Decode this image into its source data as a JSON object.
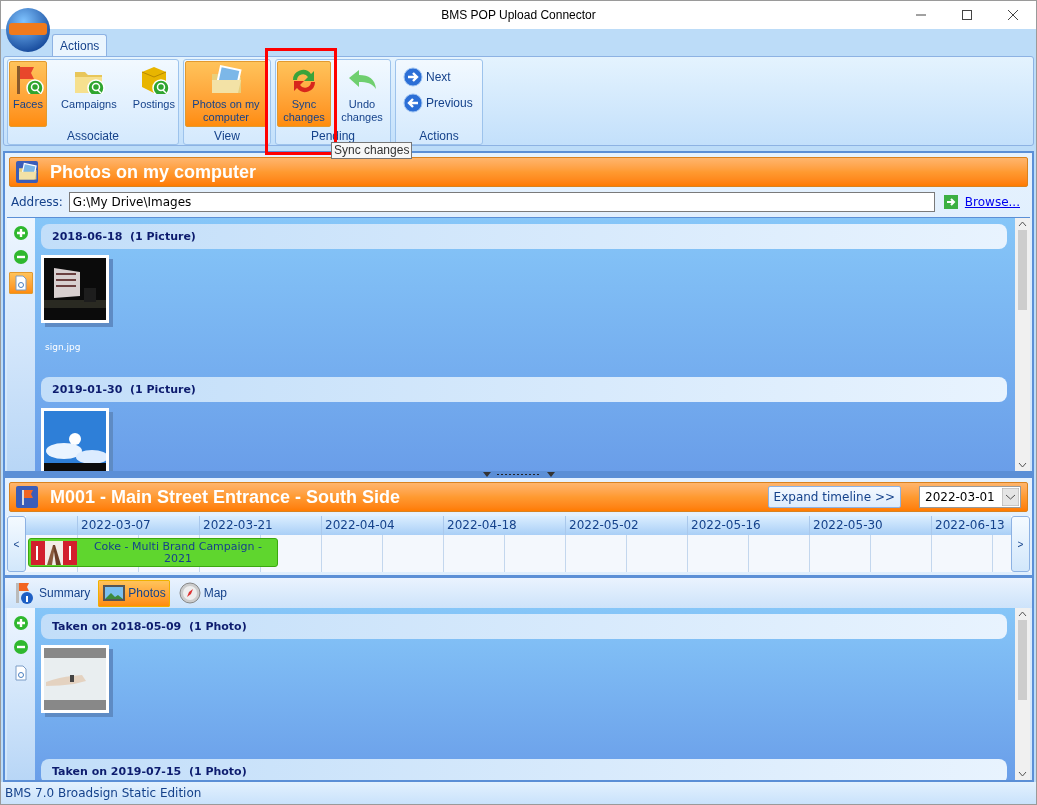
{
  "window": {
    "title": "BMS POP Upload Connector"
  },
  "ribbon": {
    "tabs": [
      {
        "label": "Actions",
        "selected": true
      }
    ],
    "groups": [
      {
        "label": "Associate",
        "buttons": [
          {
            "kind": "faces",
            "label": "Faces",
            "selected": true
          },
          {
            "kind": "campaigns",
            "label": "Campaigns",
            "selected": false
          },
          {
            "kind": "postings",
            "label": "Postings",
            "selected": false
          }
        ]
      },
      {
        "label": "View",
        "buttons": [
          {
            "kind": "photos",
            "label": "Photos on my computer",
            "selected": true
          }
        ]
      },
      {
        "label": "Pending",
        "buttons": [
          {
            "kind": "sync",
            "label": "Sync changes",
            "selected": true
          },
          {
            "kind": "undo",
            "label": "Undo changes",
            "selected": false
          }
        ]
      },
      {
        "label": "Actions",
        "buttons": [
          {
            "kind": "next",
            "label": "Next",
            "selected": false
          },
          {
            "kind": "previous",
            "label": "Previous",
            "selected": false
          }
        ]
      }
    ],
    "tooltip": "Sync changes"
  },
  "photos_panel": {
    "title": "Photos on my computer",
    "address_label": "Address:",
    "address": "G:\\My Drive\\Images",
    "browse": "Browse...",
    "tools": [
      {
        "kind": "add",
        "selected": false
      },
      {
        "kind": "remove",
        "selected": false
      },
      {
        "kind": "info",
        "selected": true
      }
    ],
    "groups": [
      {
        "header": "2018-06-18  (1 Picture)",
        "photos": [
          {
            "kind": "picture",
            "caption": "sign.jpg"
          }
        ]
      },
      {
        "header": "2019-01-30  (1 Picture)"
      }
    ]
  },
  "face_panel": {
    "title": "M001 - Main Street Entrance - South Side",
    "expand_button": "Expand timeline >>",
    "date": "2022-03-01",
    "timeline": {
      "prev": "<",
      "next": ">",
      "dates": [
        "2022-03-07",
        "2022-03-21",
        "2022-04-04",
        "2022-04-18",
        "2022-05-02",
        "2022-05-16",
        "2022-05-30",
        "2022-06-13"
      ],
      "campaigns": [
        {
          "label": "Coke - Multi Brand Campaign - 2021",
          "color": "#5fd62e"
        }
      ]
    },
    "tabs": [
      {
        "kind": "summary",
        "label": "Summary",
        "selected": false
      },
      {
        "kind": "photos",
        "label": "Photos",
        "selected": true
      },
      {
        "kind": "map",
        "label": "Map",
        "selected": false
      }
    ],
    "tools": [
      {
        "kind": "add",
        "selected": false
      },
      {
        "kind": "remove",
        "selected": false
      },
      {
        "kind": "info",
        "selected": false
      }
    ],
    "groups": [
      {
        "header": "Taken on 2018-05-09  (1 Photo)"
      },
      {
        "header": "Taken on 2019-07-15  (1 Photo)"
      }
    ]
  },
  "status_bar": "BMS 7.0 Broadsign Static Edition"
}
